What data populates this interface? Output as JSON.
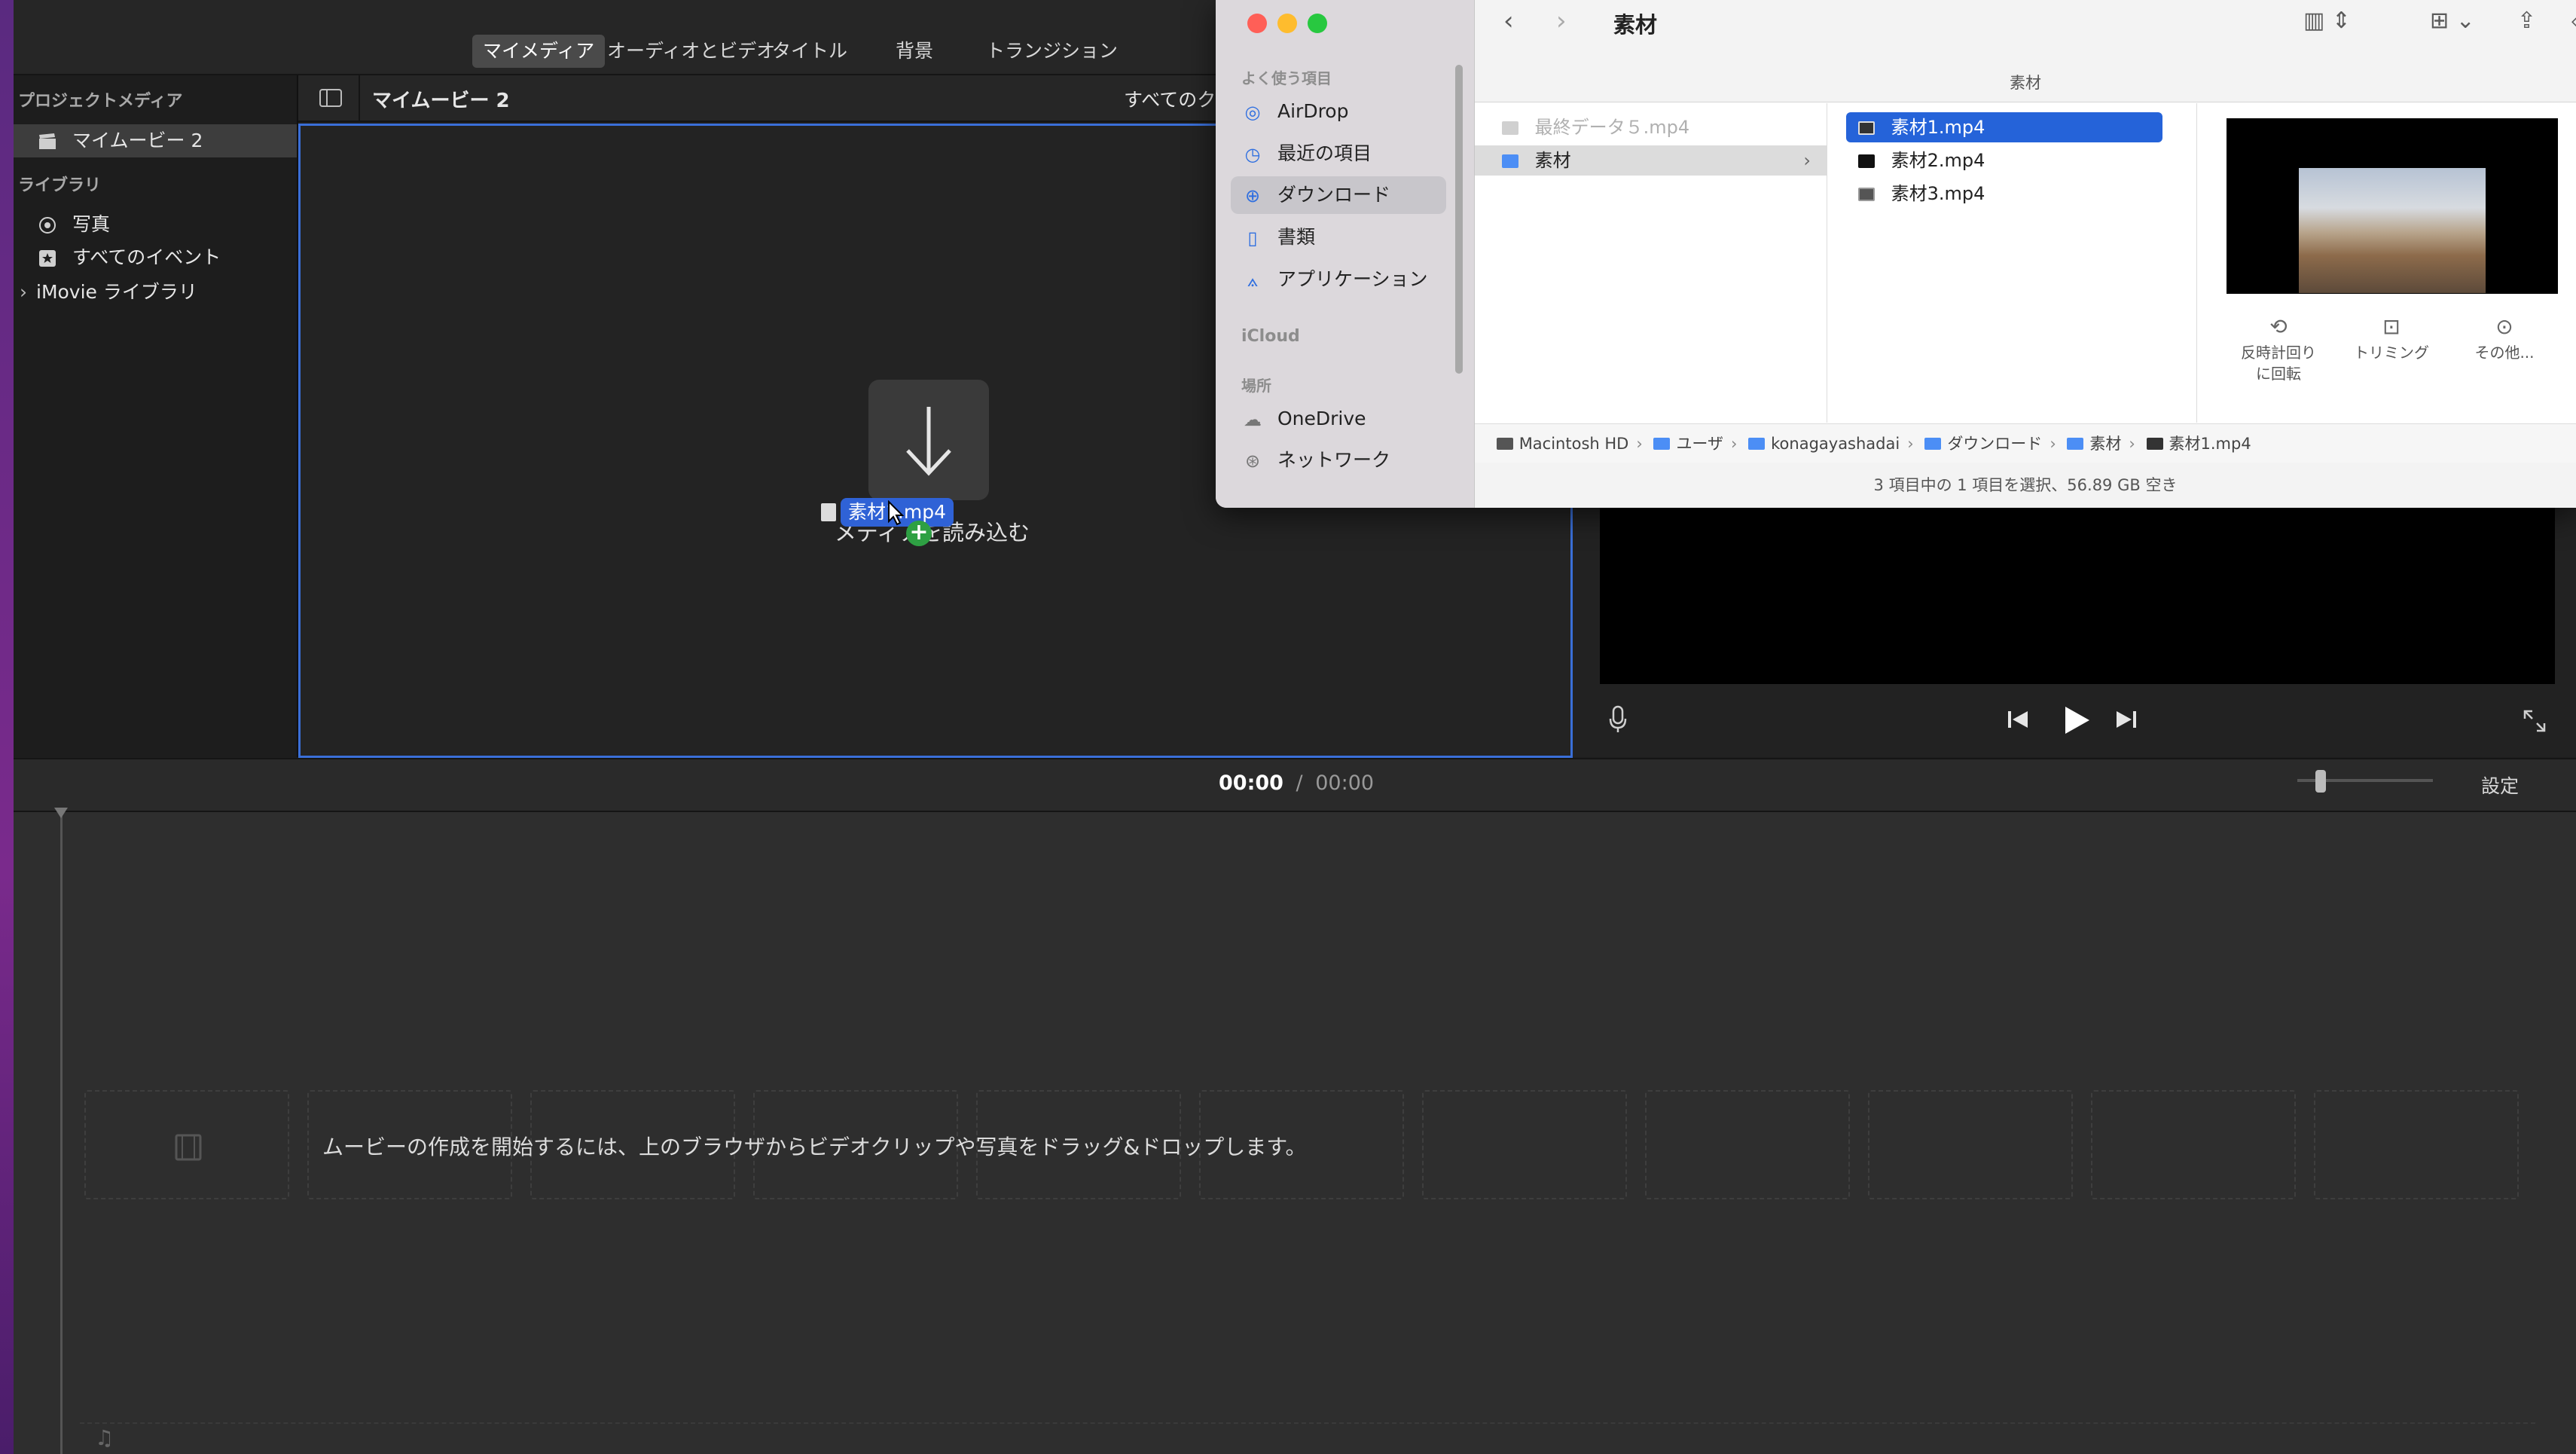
{
  "imovie": {
    "toolbar_tabs": [
      "マイメディア",
      "オーディオとビデオ",
      "タイトル",
      "背景",
      "トランジション"
    ],
    "sidebar": {
      "project_media_heading": "プロジェクトメディア",
      "project_item": "マイムービー 2",
      "library_heading": "ライブラリ",
      "photos": "写真",
      "all_events": "すべてのイベント",
      "imovie_library": "iMovie ライブラリ"
    },
    "browser": {
      "title": "マイムービー 2",
      "filter_label": "すべてのクリ",
      "import_label": "メディアを読み込む",
      "dragging_file": "素材1.mp4"
    },
    "timecode": {
      "current": "00:00",
      "separator": "/",
      "total": "00:00"
    },
    "settings_label": "設定",
    "timeline_hint": "ムービーの作成を開始するには、上のブラウザからビデオクリップや写真をドラッグ&ドロップします。"
  },
  "finder": {
    "title": "素材",
    "subtitle": "素材",
    "sidebar": {
      "favorites_heading": "よく使う項目",
      "items": [
        {
          "label": "AirDrop",
          "icon": "airdrop-icon"
        },
        {
          "label": "最近の項目",
          "icon": "clock-icon"
        },
        {
          "label": "ダウンロード",
          "icon": "download-icon"
        },
        {
          "label": "書類",
          "icon": "document-icon"
        },
        {
          "label": "アプリケーション",
          "icon": "apps-icon"
        }
      ],
      "icloud_heading": "iCloud",
      "locations_heading": "場所",
      "locations": [
        {
          "label": "OneDrive",
          "icon": "cloud-icon"
        },
        {
          "label": "ネットワーク",
          "icon": "network-icon"
        }
      ]
    },
    "column1": [
      "最終データ５.mp4",
      "素材"
    ],
    "column2": [
      "素材1.mp4",
      "素材2.mp4",
      "素材3.mp4"
    ],
    "preview_actions": [
      {
        "label": "反時計回り\nに回転",
        "icon": "rotate-icon"
      },
      {
        "label": "トリミング",
        "icon": "trim-icon"
      },
      {
        "label": "その他...",
        "icon": "more-icon"
      }
    ],
    "path": [
      "Macintosh HD",
      "ユーザ",
      "konagayashadai",
      "ダウンロード",
      "素材",
      "素材1.mp4"
    ],
    "status": "3 項目中の 1 項目を選択、56.89 GB 空き"
  },
  "colors": {
    "accent_blue": "#2f62d6",
    "plus_green": "#2ea043",
    "traffic_red": "#ff5f57",
    "traffic_yellow": "#febc2e",
    "traffic_green": "#28c840"
  }
}
